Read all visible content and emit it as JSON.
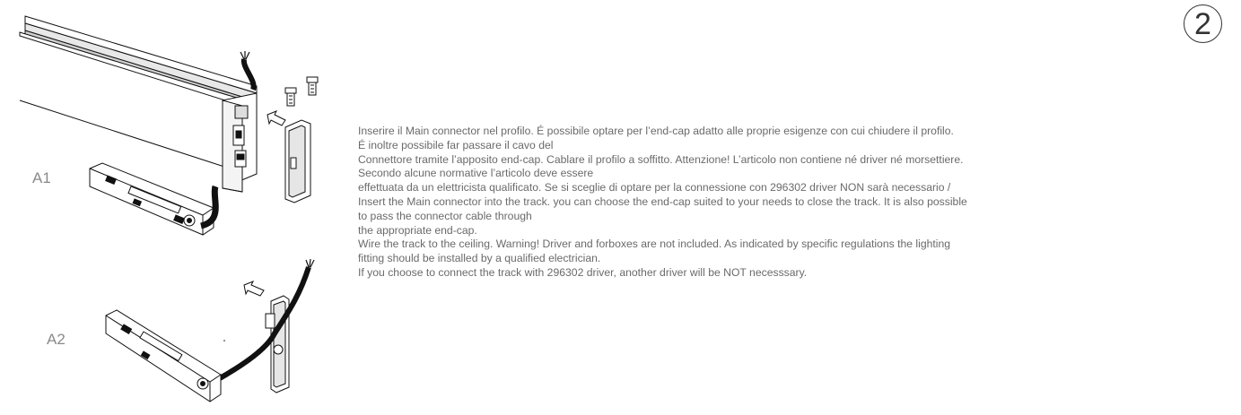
{
  "step_number": "2",
  "labels": {
    "a1": "A1",
    "a2": "A2"
  },
  "instructions": [
    "Inserire il Main connector nel profilo. É possibile optare per l’end-cap adatto alle proprie esigenze con cui chiudere il profilo.",
    "É inoltre possibile far passare il cavo del",
    "Connettore tramite l’apposito end-cap. Cablare il profilo a soffitto. Attenzione! L’articolo non contiene né driver né morsettiere.",
    "Secondo alcune normative l’articolo deve essere",
    "effettuata da un elettricista qualificato. Se si sceglie di optare per la connessione con 296302 driver NON sarà necessario /",
    "Insert the Main connector into the track. you can choose the end-cap suited to your needs to close the track.  It is also possible",
    "to pass the connector cable through",
    "the appropriate end-cap.",
    "Wire the track to the ceiling.  Warning! Driver and forboxes are not included. As indicated by specific regulations the lighting",
    "fitting should be installed by a qualified electrician.",
    "If you choose to connect the track with  296302 driver, another driver will be NOT necesssary."
  ],
  "icons": {
    "step_badge": "circled-number-icon",
    "track_profile": "track-profile-illustration",
    "connector_a1": "main-connector-illustration",
    "connector_a2": "main-connector-illustration",
    "end_cap": "end-cap-illustration",
    "screws": "screws-illustration",
    "arrows": "insert-arrow-icon"
  }
}
